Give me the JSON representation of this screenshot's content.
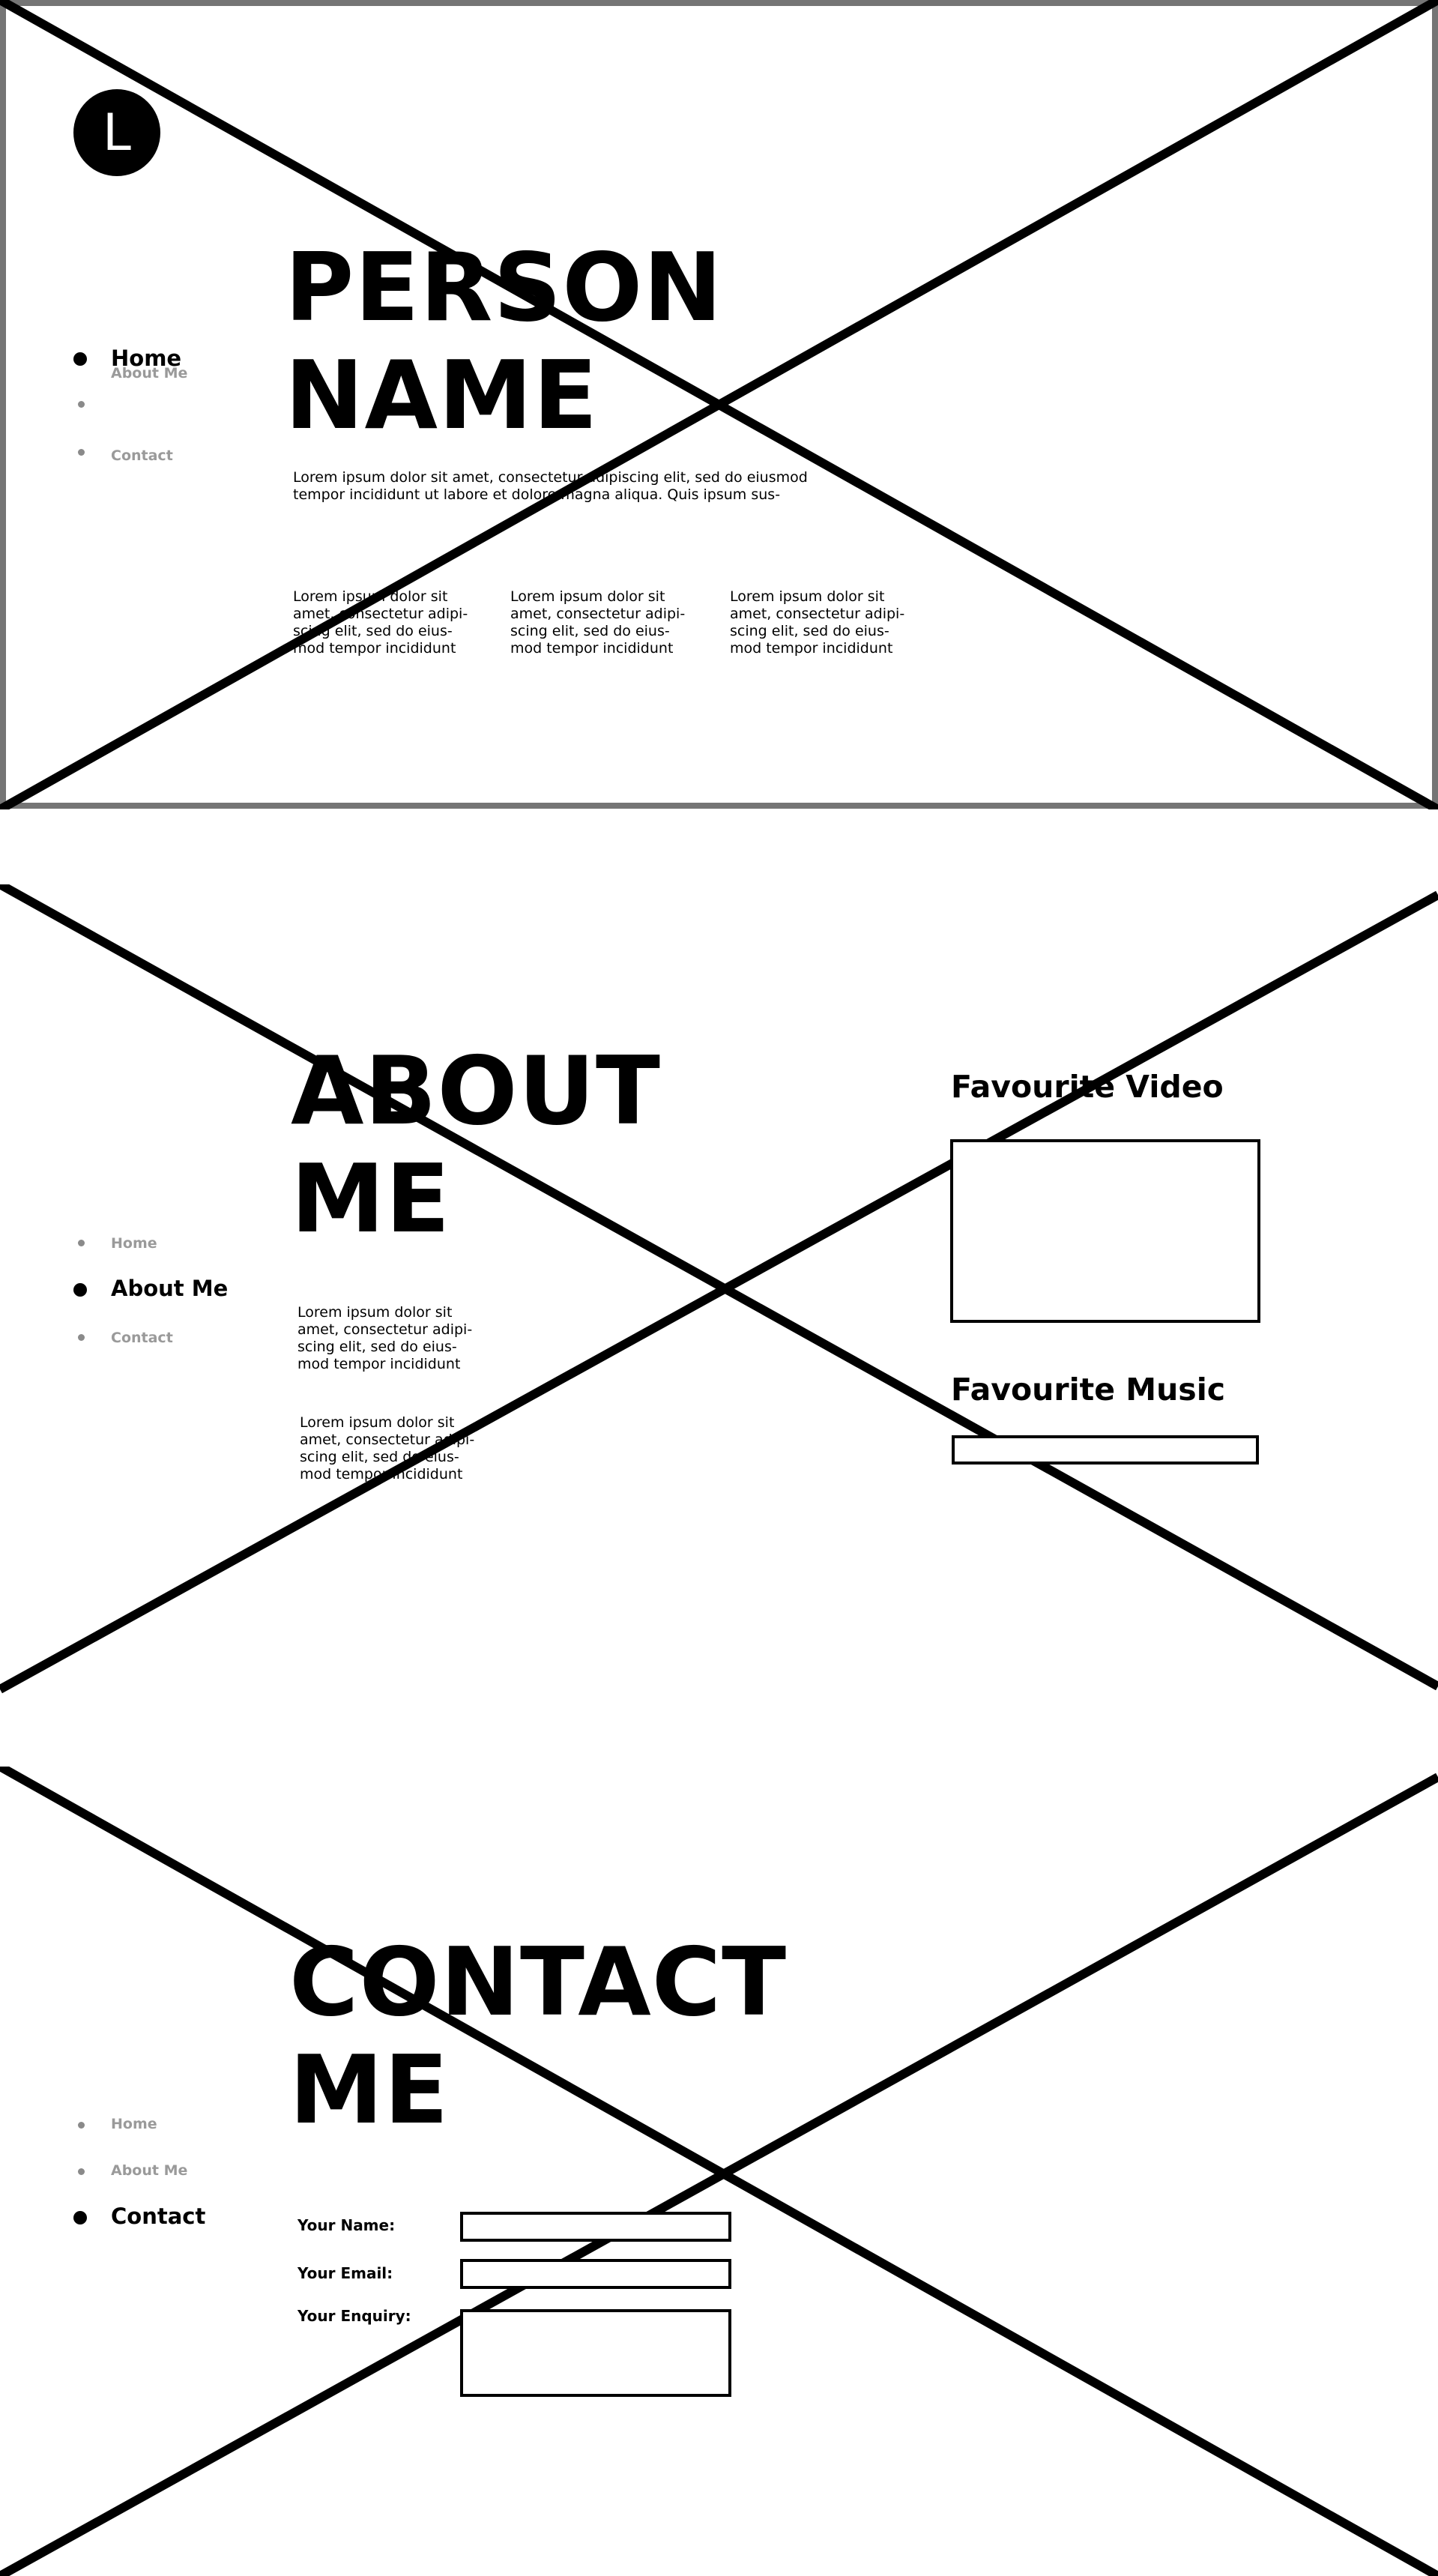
{
  "logo": {
    "letter": "L"
  },
  "hero": {
    "title_line1": "PERSON",
    "title_line2": "NAME",
    "intro": "Lorem ipsum dolor sit amet, consectetur adipiscing elit, sed do eiusmod\ntempor incididunt ut labore et dolore magna aliqua. Quis ipsum sus-",
    "columns": [
      "Lorem ipsum dolor sit\namet, consectetur adipi-\nscing elit, sed do eius-\nmod tempor incididunt",
      "Lorem ipsum dolor sit\namet, consectetur adipi-\nscing elit, sed do eius-\nmod tempor incididunt",
      "Lorem ipsum dolor sit\namet, consectetur adipi-\nscing elit, sed do eius-\nmod tempor incididunt"
    ],
    "nav": {
      "home": "Home",
      "about": "About Me",
      "contact": "Contact"
    }
  },
  "about": {
    "title_line1": "ABOUT",
    "title_line2": "ME",
    "para1": "Lorem ipsum dolor sit\namet, consectetur adipi-\nscing elit, sed do eius-\nmod tempor incididunt",
    "para2": "Lorem ipsum dolor sit\namet, consectetur adipi-\nscing elit, sed do eius-\nmod tempor incididunt",
    "video_heading": "Favourite Video",
    "music_heading": "Favourite Music",
    "nav": {
      "home": "Home",
      "about": "About Me",
      "contact": "Contact"
    }
  },
  "contact": {
    "title_line1": "CONTACT",
    "title_line2": "ME",
    "name_label": "Your Name:",
    "email_label": "Your Email:",
    "enquiry_label": "Your Enquiry:",
    "nav": {
      "home": "Home",
      "about": "About Me",
      "contact": "Contact"
    }
  },
  "colors": {
    "ink": "#000000",
    "frame": "#757575",
    "muted_nav": "#9a9a9a"
  }
}
